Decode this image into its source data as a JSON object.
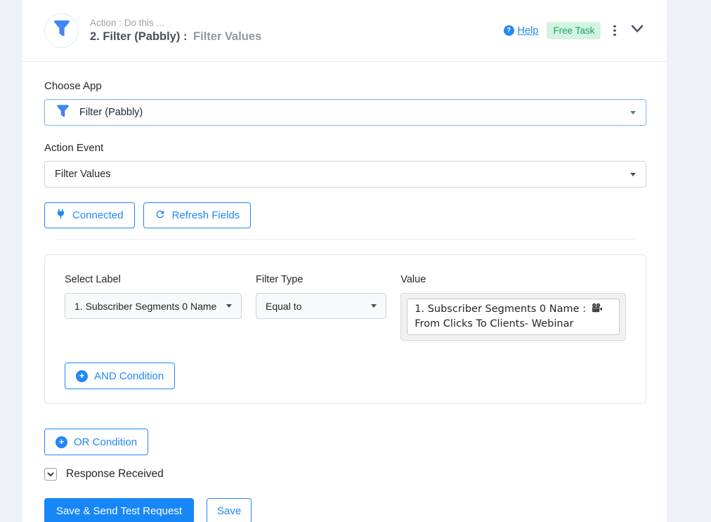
{
  "header": {
    "subtitle": "Action : Do this ...",
    "step_title": "2. Filter (Pabbly) :",
    "event_title": "Filter Values",
    "help_label": "Help",
    "badge_label": "Free Task",
    "icons": {
      "app": "filter-funnel",
      "help": "question-circle",
      "menu": "vertical-dots",
      "collapse": "chevron-down"
    }
  },
  "form": {
    "choose_app_label": "Choose App",
    "choose_app_value": "Filter (Pabbly)",
    "action_event_label": "Action Event",
    "action_event_value": "Filter Values",
    "connected_label": "Connected",
    "connected_icon": "plug",
    "refresh_label": "Refresh Fields",
    "refresh_icon": "refresh-arrows"
  },
  "condition": {
    "select_label": "Select Label",
    "select_value": "1. Subscriber Segments 0 Name",
    "filter_type_label": "Filter Type",
    "filter_type_value": "Equal to",
    "value_label": "Value",
    "value_prefix": "1. Subscriber Segments 0 Name : ",
    "value_icon": "movie-camera",
    "value_suffix": "From Clicks To Clients- Webinar",
    "and_button_label": "AND Condition"
  },
  "footer": {
    "or_button_label": "OR Condition",
    "response_label": "Response Received",
    "save_send_label": "Save & Send Test Request",
    "save_label": "Save"
  },
  "colors": {
    "accent_blue": "#1f88f6",
    "funnel_blue": "#4285f4",
    "badge_bg": "#d4f4e2",
    "badge_text": "#1ca363",
    "page_bg": "#eef1f6"
  }
}
